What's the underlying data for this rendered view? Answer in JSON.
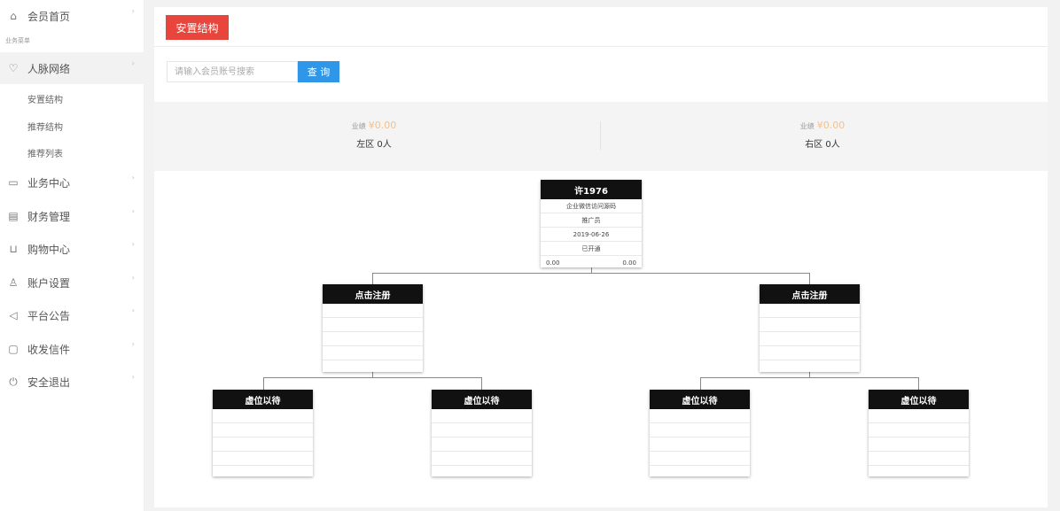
{
  "sidebar": {
    "home": "会员首页",
    "section_label": "业务菜单",
    "network": "人脉网络",
    "sub_items": [
      "安置结构",
      "推荐结构",
      "推荐列表"
    ],
    "business": "业务中心",
    "finance": "财务管理",
    "shopping": "购物中心",
    "account": "账户设置",
    "notice": "平台公告",
    "mail": "收发信件",
    "logout": "安全退出"
  },
  "page": {
    "tab_label": "安置结构",
    "search_placeholder": "请输入会员账号搜索",
    "search_button": "查 询"
  },
  "stats": {
    "left": {
      "amount_label": "业绩",
      "amount": "¥0.00",
      "count": "左区 0人"
    },
    "right": {
      "amount_label": "业绩",
      "amount": "¥0.00",
      "count": "右区 0人"
    }
  },
  "tree": {
    "root": {
      "name": "许1976",
      "rows": [
        "企业微信访问源码",
        "推广员",
        "2019-06-26",
        "已开通"
      ],
      "left_value": "0.00",
      "right_value": "0.00"
    },
    "level2": [
      {
        "name": "点击注册"
      },
      {
        "name": "点击注册"
      }
    ],
    "level3": [
      {
        "name": "虚位以待"
      },
      {
        "name": "虚位以待"
      },
      {
        "name": "虚位以待"
      },
      {
        "name": "虚位以待"
      }
    ]
  }
}
